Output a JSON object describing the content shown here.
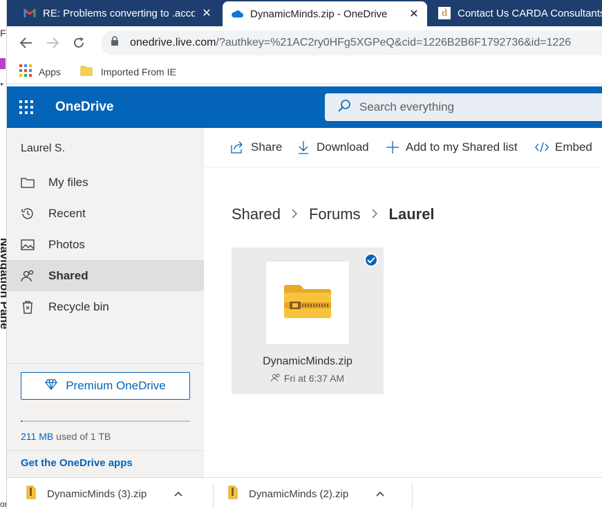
{
  "underlying_window": {
    "letter": "F",
    "vertical_label": "Navigation Pane",
    "bottom_text": "or"
  },
  "browser": {
    "tabs": [
      {
        "title": "RE: Problems converting to .accdb",
        "icon": "gmail-icon",
        "close": "✕"
      },
      {
        "title": "DynamicMinds.zip - OneDrive",
        "icon": "onedrive-cloud-icon",
        "close": "✕"
      },
      {
        "title": "Contact Us CARDA Consultants",
        "icon": "carda-d-icon"
      }
    ],
    "address": {
      "host": "onedrive.live.com",
      "rest": "/?authkey=%21AC2ry0HFg5XGPeQ&cid=1226B2B6F1792736&id=1226"
    },
    "bookmarks": [
      {
        "label": "Apps",
        "icon": "apps-grid-icon"
      },
      {
        "label": "Imported From IE",
        "icon": "folder-icon"
      }
    ]
  },
  "onedrive": {
    "brand": "OneDrive",
    "search_placeholder": "Search everything",
    "user_name": "Laurel S.",
    "nav": [
      {
        "label": "My files",
        "icon": "folder-outline-icon"
      },
      {
        "label": "Recent",
        "icon": "history-icon"
      },
      {
        "label": "Photos",
        "icon": "image-icon"
      },
      {
        "label": "Shared",
        "icon": "people-icon",
        "selected": true
      },
      {
        "label": "Recycle bin",
        "icon": "trash-icon"
      }
    ],
    "premium_label": "Premium OneDrive",
    "storage": {
      "used": "211 MB",
      "suffix": " used of 1 TB",
      "fraction_used": 0.0002
    },
    "apps_link": "Get the OneDrive apps",
    "commands": {
      "share": "Share",
      "download": "Download",
      "add": "Add to my Shared list",
      "embed": "Embed"
    },
    "breadcrumb": [
      "Shared",
      "Forums",
      "Laurel"
    ],
    "file": {
      "name": "DynamicMinds.zip",
      "meta": "Fri at 6:37 AM",
      "selected": true
    }
  },
  "downloads": [
    {
      "name": "DynamicMinds (3).zip"
    },
    {
      "name": "DynamicMinds (2).zip"
    }
  ],
  "colors": {
    "tabbar": "#1d3e6e",
    "onedrive_blue": "#0364b8",
    "sidebar_bg": "#f3f2f1",
    "folder_yellow": "#f8c33c"
  }
}
